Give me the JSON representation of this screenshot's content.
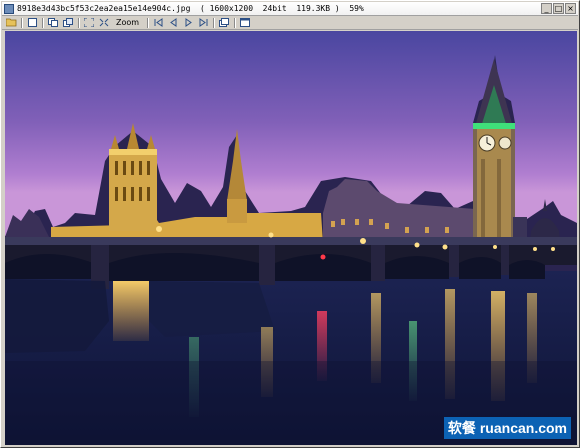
{
  "window": {
    "title": "8918e3d43bc5f53c2ea2ea15e14e904c.jpg  ( 1600x1200  24bit  119.3KB )  59%",
    "min_glyph": "_",
    "max_glyph": "□",
    "close_glyph": "×"
  },
  "toolbar": {
    "zoom_label": "Zoom",
    "icons": [
      "open-icon",
      "save-icon",
      "copy-icon",
      "paste-icon",
      "fit-icon",
      "actual-size-icon",
      "first-icon",
      "prev-icon",
      "next-icon",
      "last-icon",
      "window-icon",
      "fullscreen-icon"
    ]
  },
  "watermark": {
    "cn": "软餐",
    "url": "ruancan.com"
  },
  "colors": {
    "sky_top": "#4a46a0",
    "sky_mid": "#9a6cc0",
    "sky_low": "#c08ad4",
    "water": "#141b44",
    "lights": "#f4c24a",
    "clock_green": "#3fe07a",
    "brand_blue": "#0c62b4"
  }
}
